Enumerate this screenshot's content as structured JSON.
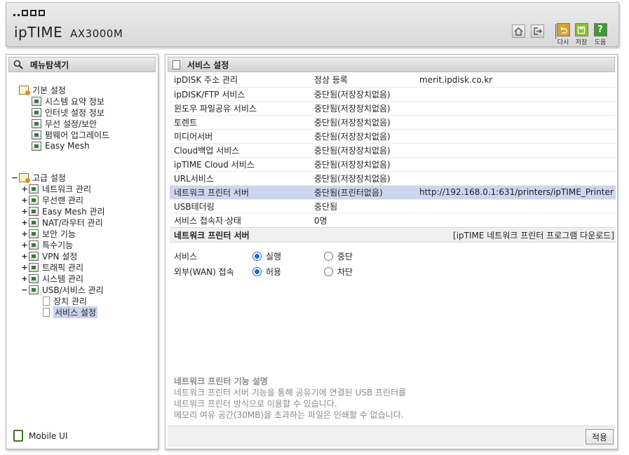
{
  "header": {
    "logo_text": "ipTIME",
    "model": "AX3000M",
    "tools": [
      {
        "label": "다시",
        "color": "#d8a230",
        "icon": "undo-icon"
      },
      {
        "label": "저장",
        "color": "#8fbf30",
        "icon": "save-icon"
      },
      {
        "label": "도움",
        "color": "#3f9a36",
        "icon": "help-icon"
      }
    ]
  },
  "sidebar": {
    "title": "메뉴탐색기",
    "basic": {
      "label": "기본 설정",
      "items": [
        "시스템 요약 정보",
        "인터넷 설정 정보",
        "무선 설정/보안",
        "펌웨어 업그레이드",
        "Easy Mesh"
      ]
    },
    "advanced": {
      "label": "고급 설정",
      "items": [
        "네트워크 관리",
        "무선랜 관리",
        "Easy Mesh 관리",
        "NAT/라우터 관리",
        "보안 기능",
        "특수기능",
        "VPN 설정",
        "트래픽 관리",
        "시스템 관리",
        "USB/서비스 관리"
      ],
      "usb_children": [
        "장치 관리",
        "서비스 설정"
      ]
    },
    "mobile_ui": "Mobile UI"
  },
  "main": {
    "title": "서비스 설정",
    "rows": [
      {
        "name": "ipDISK 주소 관리",
        "status": "정상 등록",
        "extra": "merit.ipdisk.co.kr"
      },
      {
        "name": "ipDISK/FTP 서비스",
        "status": "중단됨(저장장치없음)",
        "extra": ""
      },
      {
        "name": "윈도우 파일공유 서비스",
        "status": "중단됨(저장장치없음)",
        "extra": ""
      },
      {
        "name": "토렌트",
        "status": "중단됨(저장장치없음)",
        "extra": ""
      },
      {
        "name": "미디어서버",
        "status": "중단됨(저장장치없음)",
        "extra": ""
      },
      {
        "name": "Cloud백업 서비스",
        "status": "중단됨(저장장치없음)",
        "extra": ""
      },
      {
        "name": "ipTIME Cloud 서비스",
        "status": "중단됨(저장장치없음)",
        "extra": ""
      },
      {
        "name": "URL서비스",
        "status": "중단됨(저장장치없음)",
        "extra": ""
      },
      {
        "name": "네트워크 프린터 서버",
        "status": "중단됨(프린터없음)",
        "extra": "http://192.168.0.1:631/printers/ipTIME_Printer"
      },
      {
        "name": "USB테더링",
        "status": "중단됨",
        "extra": ""
      },
      {
        "name": "서비스 접속자 상태",
        "status": "0명",
        "extra": ""
      }
    ],
    "highlight_color": "#ccd6ee",
    "printer_section": {
      "title": "네트워크 프린터 서버",
      "download_link": "[ipTIME 네트워크 프린터 프로그램 다운로드]",
      "service_label": "서비스",
      "service_on": "실행",
      "service_off": "중단",
      "wan_label": "외부(WAN) 접속",
      "wan_on": "허용",
      "wan_off": "차단"
    },
    "description": {
      "title": "네트워크 프린터 기능 설명",
      "line1": "네트워크 프린터 서버 기능을 통해 공유기에 연결된 USB 프린터를",
      "line2": "네트워크 프린터 방식으로 이용할 수 있습니다.",
      "line3": "메모리 여유 공간(30MB)을 초과하는 파일은 인쇄할 수 없습니다."
    },
    "apply_label": "적용"
  }
}
